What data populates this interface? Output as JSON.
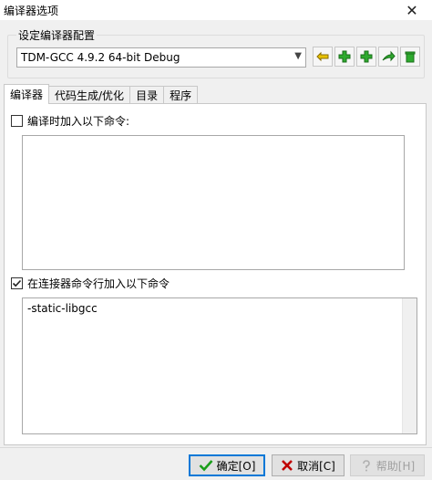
{
  "window": {
    "title": "编译器选项",
    "close_glyph": "✕"
  },
  "config_group": {
    "label": "设定编译器配置",
    "selected_profile": "TDM-GCC 4.9.2 64-bit Debug",
    "icons": [
      "rename-icon",
      "add-icon",
      "add-copy-icon",
      "export-icon",
      "delete-icon"
    ]
  },
  "tabs": [
    {
      "label": "编译器",
      "active": true
    },
    {
      "label": "代码生成/优化",
      "active": false
    },
    {
      "label": "目录",
      "active": false
    },
    {
      "label": "程序",
      "active": false
    }
  ],
  "compiler_section": {
    "checkbox_label": "编译时加入以下命令:",
    "checked": false,
    "text": ""
  },
  "linker_section": {
    "checkbox_label": "在连接器命令行加入以下命令",
    "checked": true,
    "text": "-static-libgcc"
  },
  "buttons": {
    "ok": "确定[O]",
    "cancel": "取消[C]",
    "help": "帮助[H]"
  },
  "colors": {
    "ok_check": "#1a9e1a",
    "cancel_x": "#c00000",
    "accent_border": "#0078d7",
    "add_green": "#2eaa2e"
  }
}
